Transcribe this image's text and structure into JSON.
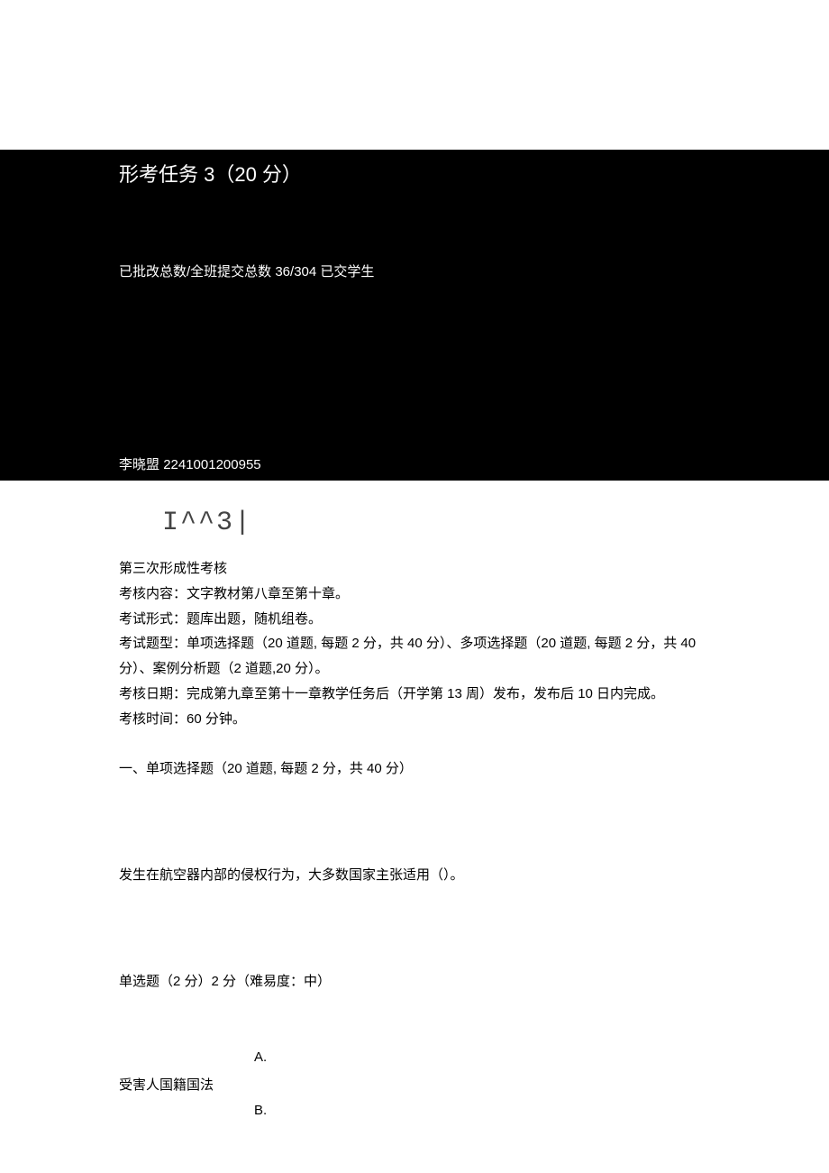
{
  "header": {
    "title": "形考任务 3（20 分）"
  },
  "stats": {
    "label_prefix": "已批改总数/全班提交总数 ",
    "ratio": "36/304",
    "label_suffix": " 已交学生"
  },
  "student": {
    "name": "李晓盟",
    "id": "2241001200955"
  },
  "decor": "I^^3|",
  "intro": {
    "line1": "第三次形成性考核",
    "line2": "考核内容：文字教材第八章至第十章。",
    "line3": "考试形式：题库出题，随机组卷。",
    "line4": "考试题型：单项选择题（20 道题, 每题 2 分，共 40 分）、多项选择题（20 道题, 每题 2 分，共 40分）、案例分析题（2 道题,20 分）。",
    "line5": "考核日期：完成第九章至第十一章教学任务后（开学第 13 周）发布，发布后 10 日内完成。",
    "line6": "考核时间：60 分钟。"
  },
  "section": {
    "heading": "一、单项选择题（20 道题, 每题 2 分，共 40 分）"
  },
  "question": {
    "stem": "发生在航空器内部的侵权行为，大多数国家主张适用（）。",
    "meta": "单选题（2 分）2 分（难易度：中）",
    "options": {
      "a_letter": "A.",
      "a_text": "受害人国籍国法",
      "b_letter": "B."
    }
  }
}
